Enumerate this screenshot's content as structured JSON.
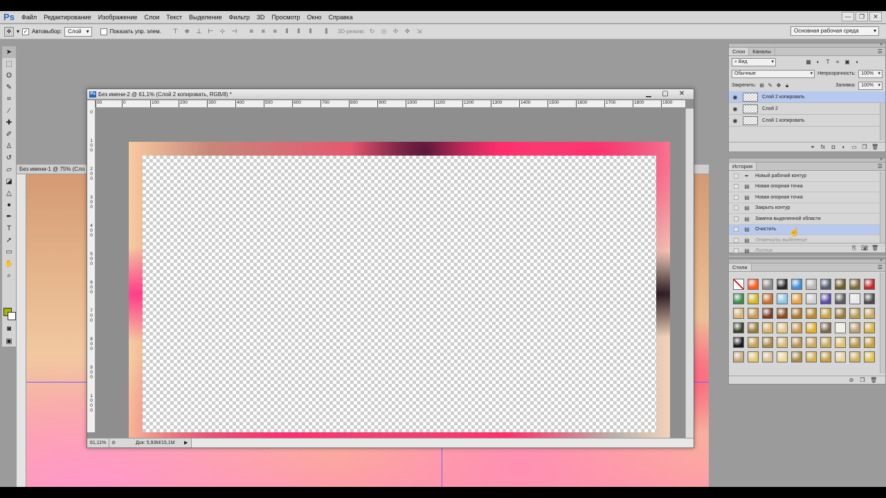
{
  "app": {
    "logo": "Ps",
    "menu": [
      "Файл",
      "Редактирование",
      "Изображение",
      "Слои",
      "Текст",
      "Выделение",
      "Фильтр",
      "3D",
      "Просмотр",
      "Окно",
      "Справка"
    ],
    "window_controls": [
      "—",
      "❐",
      "✕"
    ]
  },
  "options": {
    "autoselect_label": "Автовыбор:",
    "autoselect_value": "Слой",
    "show_controls_label": "Показать упр. элем.",
    "mode3d_label": "3D-режим:",
    "workspace": "Основная рабочая среда"
  },
  "colors": {
    "foreground": "#a8b400",
    "background": "#ffffff",
    "selection": "#b7c9ee"
  },
  "doc_back": {
    "title": "Без имени-1 @ 75% (Сло"
  },
  "doc_main": {
    "title": "Без имени-2 @ 61,1% (Слой 2 копировать, RGB/8) *",
    "zoom": "61,11%",
    "doc_info": "Док: 5,93M/15,1M",
    "ruler_h": [
      "00",
      "0",
      "100",
      "200",
      "300",
      "400",
      "500",
      "600",
      "700",
      "800",
      "900",
      "1000",
      "1100",
      "1200",
      "1300",
      "1400",
      "1500",
      "1600",
      "1700",
      "1800",
      "1900"
    ],
    "ruler_v": [
      "0",
      "1 0 0",
      "2 0 0",
      "3 0 0",
      "4 0 0",
      "5 0 0",
      "6 0 0",
      "7 0 0",
      "8 0 0",
      "9 0 0",
      "1 0 0 0"
    ]
  },
  "layers_panel": {
    "tabs": [
      "Слои",
      "Каналы"
    ],
    "filter": "Вид",
    "blend_mode": "Обычные",
    "opacity_label": "Непрозрачность:",
    "opacity": "100%",
    "lock_label": "Закрепить:",
    "fill_label": "Заливка:",
    "fill": "100%",
    "layers": [
      {
        "name": "Слой 2 копировать",
        "selected": true
      },
      {
        "name": "Слой 2",
        "selected": false
      },
      {
        "name": "Слой 1 копировать",
        "selected": false
      }
    ]
  },
  "history_panel": {
    "tab": "История",
    "items": [
      {
        "name": "Новый рабочий контур",
        "state": "normal",
        "icon": "pen-icon"
      },
      {
        "name": "Новая опорная точка",
        "state": "normal",
        "icon": "history-step-icon"
      },
      {
        "name": "Новая опорная точка",
        "state": "normal",
        "icon": "history-step-icon"
      },
      {
        "name": "Закрыть контур",
        "state": "normal",
        "icon": "history-step-icon"
      },
      {
        "name": "Замена выделенной области",
        "state": "normal",
        "icon": "history-step-icon"
      },
      {
        "name": "Очистить",
        "state": "selected",
        "icon": "history-step-icon"
      },
      {
        "name": "Отменить выделение",
        "state": "undone",
        "icon": "history-step-icon"
      },
      {
        "name": "Листик",
        "state": "undone",
        "icon": "history-step-icon"
      }
    ]
  },
  "styles_panel": {
    "tab": "Стили",
    "swatches": [
      "#ffffff",
      "#ff5a1a",
      "#8a8a8a",
      "#2a2a2a",
      "#3c8fd8",
      "#b8b8b8",
      "#555d70",
      "#6b5a2a",
      "#7a6a3a",
      "#c42828",
      "#3a8a4a",
      "#d8b820",
      "#c8702a",
      "#8ec8e8",
      "#e8a040",
      "#d0d0d0",
      "#5a4aa8",
      "#5a5a5a",
      "#e8e8e8",
      "#4a4a4a",
      "#d8b070",
      "#c89850",
      "#7a3a2a",
      "#8a4a1a",
      "#a8782a",
      "#b8882a",
      "#c8a040",
      "#9a7a3a",
      "#b89a50",
      "#c8a860",
      "#3a3a2a",
      "#9a7a3a",
      "#d8b060",
      "#e8c880",
      "#c89850",
      "#e8b020",
      "#7a6a4a",
      "#f0f0e0",
      "#b8a070",
      "#d8b040",
      "#1a1a1a",
      "#c8a050",
      "#a8884a",
      "#d8b870",
      "#b89050",
      "#d0a860",
      "#c8a858",
      "#e0c068",
      "#b89848",
      "#c8a040",
      "#c8a878",
      "#e8c870",
      "#d8c090",
      "#f0d890",
      "#a88848",
      "#d8b050",
      "#c8a040",
      "#e8d098",
      "#d0b060",
      "#e0c050"
    ]
  }
}
